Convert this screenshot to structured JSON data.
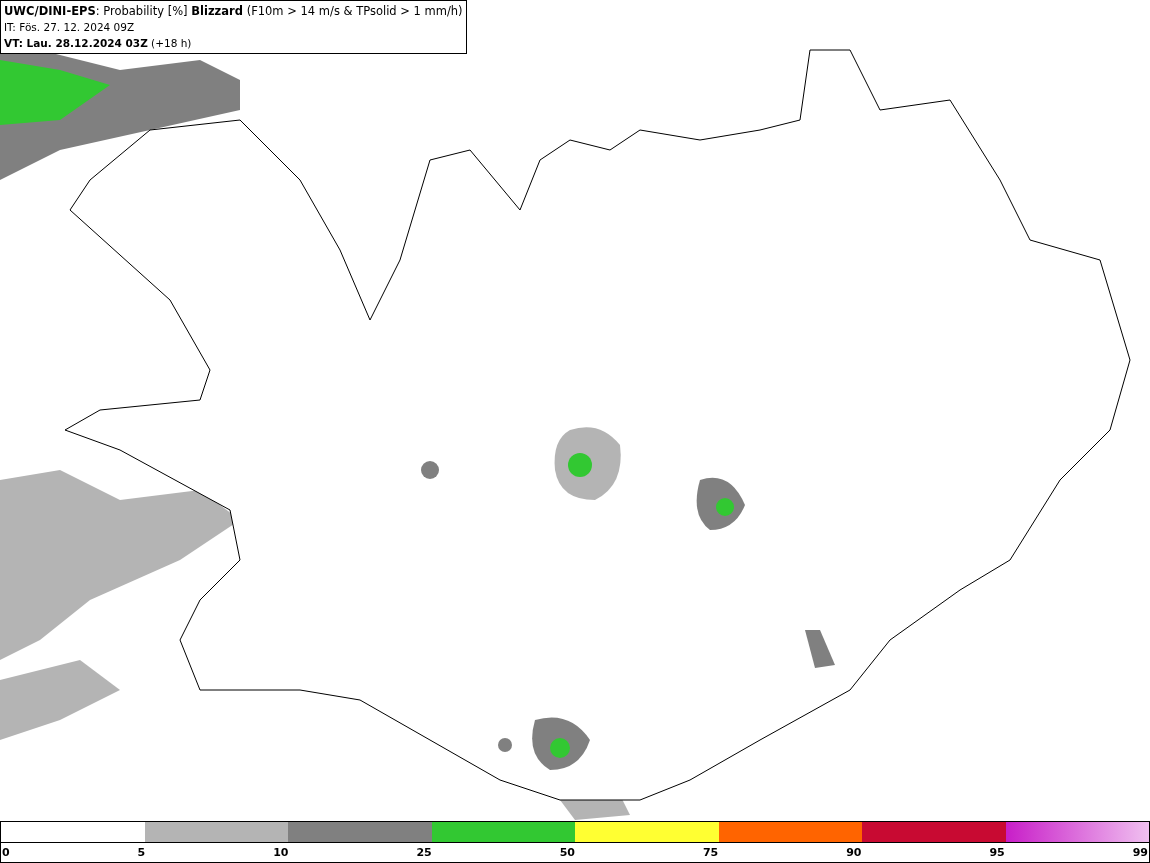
{
  "title_box": {
    "lines": [
      "**UWC/DINI-EPS**: Probability [%] **Blizzard** (F10m > 14 m/s & TPsolid > 1 mm/h)",
      "IT: Fös. 27. 12. 2024 09Z",
      "**VT: Lau. 28.12.2024 03Z** (+18 h)"
    ]
  },
  "legend": {
    "segments": [
      {
        "kind": "solid",
        "color": "#b4b4b4"
      },
      {
        "kind": "solid",
        "color": "#808080"
      },
      {
        "kind": "solid",
        "color": "#32c832"
      },
      {
        "kind": "solid",
        "color": "#ffff32"
      },
      {
        "kind": "solid",
        "color": "#ff6400"
      },
      {
        "kind": "solid",
        "color": "#c80a32"
      },
      {
        "kind": "gradient",
        "color": "#c81ec8"
      }
    ],
    "labels": [
      "0",
      "5",
      "10",
      "25",
      "50",
      "75",
      "90",
      "95",
      "99"
    ]
  }
}
